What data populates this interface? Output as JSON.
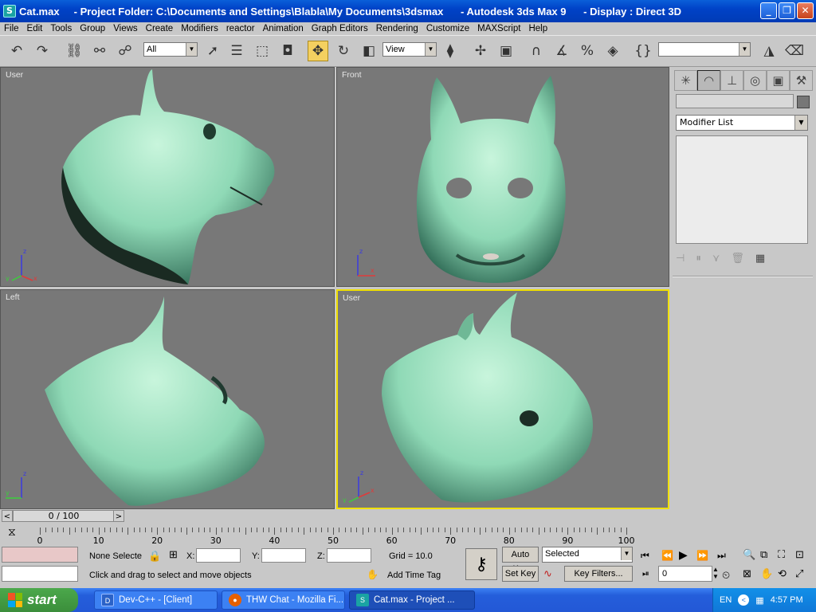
{
  "window": {
    "title": "Cat.max     - Project Folder: C:\\Documents and Settings\\Blabla\\My Documents\\3dsmax      - Autodesk 3ds Max 9      - Display : Direct 3D",
    "icon": "3dsmax-app-icon"
  },
  "menu": [
    "File",
    "Edit",
    "Tools",
    "Group",
    "Views",
    "Create",
    "Modifiers",
    "reactor",
    "Animation",
    "Graph Editors",
    "Rendering",
    "Customize",
    "MAXScript",
    "Help"
  ],
  "toolbar": {
    "selection_filter": "All",
    "reference_coord": "View",
    "named_selection": ""
  },
  "viewports": [
    {
      "label": "User"
    },
    {
      "label": "Front"
    },
    {
      "label": "Left"
    },
    {
      "label": "User"
    }
  ],
  "axis": {
    "x": "x",
    "y": "y",
    "z": "z"
  },
  "command_panel": {
    "object_name": "",
    "modifier_list": "Modifier List"
  },
  "time": {
    "slider_text": "0 / 100",
    "ruler_labels": [
      "0",
      "10",
      "20",
      "30",
      "40",
      "50",
      "60",
      "70",
      "80",
      "90",
      "100"
    ]
  },
  "status": {
    "selection": "None Selecte",
    "x_label": "X:",
    "y_label": "Y:",
    "z_label": "Z:",
    "x_value": "",
    "y_value": "",
    "z_value": "",
    "grid": "Grid = 10.0",
    "prompt": "Click and drag to select and move objects",
    "add_time_tag": "Add Time Tag",
    "auto_key": "Auto Key",
    "set_key": "Set Key",
    "key_mode": "Selected",
    "key_filters": "Key Filters...",
    "frame": "0"
  },
  "taskbar": {
    "start": "start",
    "tasks": [
      {
        "label": "Dev-C++ - [Client]",
        "icon": "devcpp-icon"
      },
      {
        "label": "THW Chat - Mozilla Fi...",
        "icon": "firefox-icon"
      },
      {
        "label": "Cat.max     - Project ...",
        "icon": "3dsmax-icon"
      }
    ],
    "lang": "EN",
    "clock": "4:57 PM"
  },
  "colors": {
    "title_bar": "#0a5fd9",
    "viewport_bg": "#787878",
    "active_viewport_border": "#f0e000",
    "model": "#8fd9b6"
  }
}
